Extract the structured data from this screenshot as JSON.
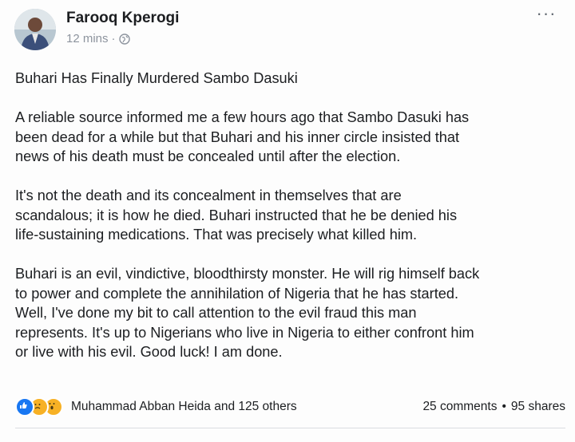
{
  "post": {
    "author": "Farooq Kperogi",
    "time": "12 mins",
    "separator": "·",
    "privacy_icon": "globe-icon",
    "more_icon": "more-options-icon",
    "title": "Buhari Has Finally Murdered Sambo Dasuki",
    "paragraphs": [
      "A reliable source informed me a few hours ago that Sambo Dasuki has\nbeen dead for a while but that Buhari and his inner circle insisted that\nnews of his death must be concealed until after the election.",
      "It's not the death and its concealment in themselves that are\nscandalous; it is how he died. Buhari instructed that he be denied his\nlife-sustaining medications. That was precisely what killed him.",
      "Buhari is an evil, vindictive, bloodthirsty monster. He will rig himself back\nto power and complete the annihilation of Nigeria that he has started.\nWell, I've done my bit to call attention to the evil fraud this man\nrepresents. It's up to Nigerians who live in Nigeria to either confront him\nor live with his evil. Good luck! I am done."
    ]
  },
  "footer": {
    "reactions": [
      "like-reaction-icon",
      "sad-reaction-icon",
      "wow-reaction-icon"
    ],
    "reaction_text": "Muhammad Abban Heida and 125 others",
    "comments": "25 comments",
    "dot": "•",
    "shares": "95 shares"
  },
  "colors": {
    "text": "#1c1e21",
    "meta": "#8d949e",
    "like_blue": "#1877f2",
    "reaction_yellow": "#f7b125"
  }
}
